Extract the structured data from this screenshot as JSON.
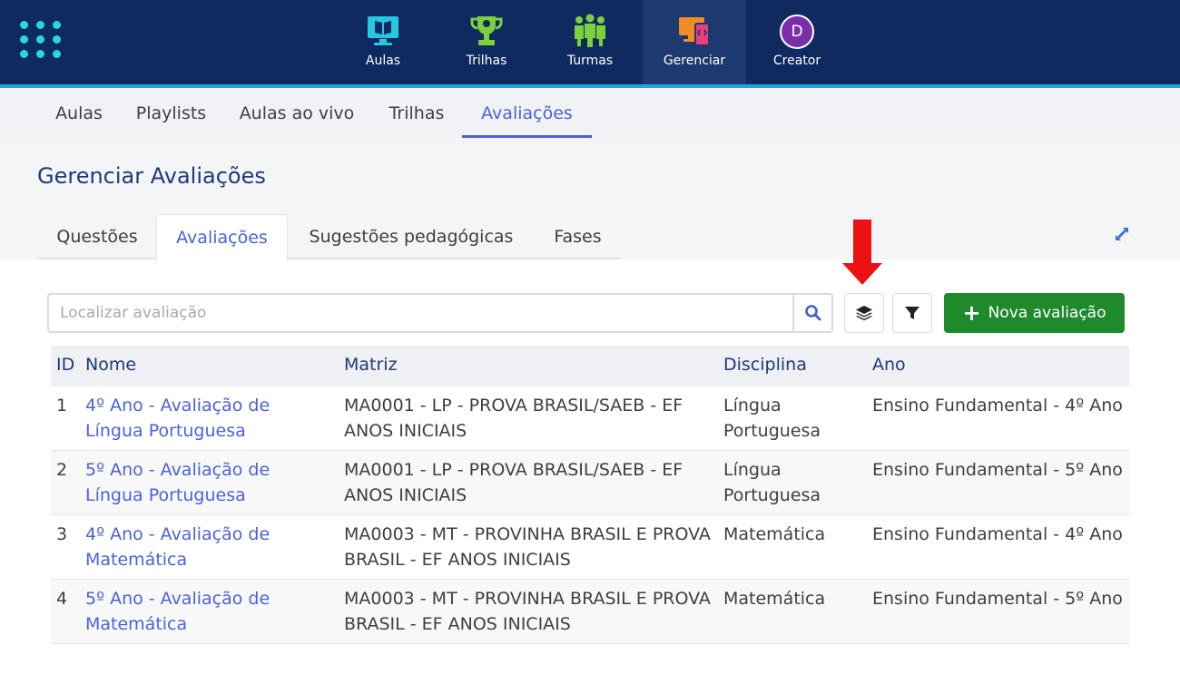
{
  "topnav": {
    "items": [
      {
        "label": "Aulas",
        "icon": "monitor-book-icon"
      },
      {
        "label": "Trilhas",
        "icon": "trophy-icon"
      },
      {
        "label": "Turmas",
        "icon": "group-icon"
      },
      {
        "label": "Gerenciar",
        "icon": "devices-icon",
        "active": true
      },
      {
        "label": "Creator",
        "icon": "avatar",
        "avatar_letter": "D"
      }
    ],
    "colors": {
      "bar": "#0e2a5e",
      "active": "#1d3a70",
      "accent_line": "#1fa3e6"
    }
  },
  "subnav": {
    "items": [
      {
        "label": "Aulas"
      },
      {
        "label": "Playlists"
      },
      {
        "label": "Aulas ao vivo"
      },
      {
        "label": "Trilhas"
      },
      {
        "label": "Avaliações",
        "active": true
      }
    ]
  },
  "page": {
    "title": "Gerenciar Avaliações"
  },
  "tabs": [
    {
      "label": "Questões"
    },
    {
      "label": "Avaliações",
      "active": true
    },
    {
      "label": "Sugestões pedagógicas"
    },
    {
      "label": "Fases"
    }
  ],
  "toolbar": {
    "search_placeholder": "Localizar avaliação",
    "search_value": "",
    "new_button_label": "Nova avaliação",
    "new_button_color": "#1f8a2c"
  },
  "table": {
    "headers": [
      "ID",
      "Nome",
      "Matriz",
      "Disciplina",
      "Ano"
    ],
    "rows": [
      {
        "id": "1",
        "nome_l1": "4º Ano - Avaliação de",
        "nome_l2": "Língua Portuguesa",
        "matriz_l1": "MA0001 - LP - PROVA BRASIL/SAEB - EF",
        "matriz_l2": "ANOS INICIAIS",
        "disc_l1": "Língua",
        "disc_l2": "Portuguesa",
        "ano": "Ensino Fundamental - 4º Ano"
      },
      {
        "id": "2",
        "nome_l1": "5º Ano - Avaliação de",
        "nome_l2": "Língua Portuguesa",
        "matriz_l1": "MA0001 - LP - PROVA BRASIL/SAEB - EF",
        "matriz_l2": "ANOS INICIAIS",
        "disc_l1": "Língua",
        "disc_l2": "Portuguesa",
        "ano": "Ensino Fundamental - 5º Ano"
      },
      {
        "id": "3",
        "nome_l1": "4º Ano - Avaliação de",
        "nome_l2": "Matemática",
        "matriz_l1": "MA0003 - MT - PROVINHA BRASIL E PROVA",
        "matriz_l2": "BRASIL - EF ANOS INICIAIS",
        "disc_l1": "Matemática",
        "disc_l2": "",
        "ano": "Ensino Fundamental - 4º Ano"
      },
      {
        "id": "4",
        "nome_l1": "5º Ano - Avaliação de",
        "nome_l2": "Matemática",
        "matriz_l1": "MA0003 - MT - PROVINHA BRASIL E PROVA",
        "matriz_l2": "BRASIL - EF ANOS INICIAIS",
        "disc_l1": "Matemática",
        "disc_l2": "",
        "ano": "Ensino Fundamental - 5º Ano"
      }
    ]
  }
}
